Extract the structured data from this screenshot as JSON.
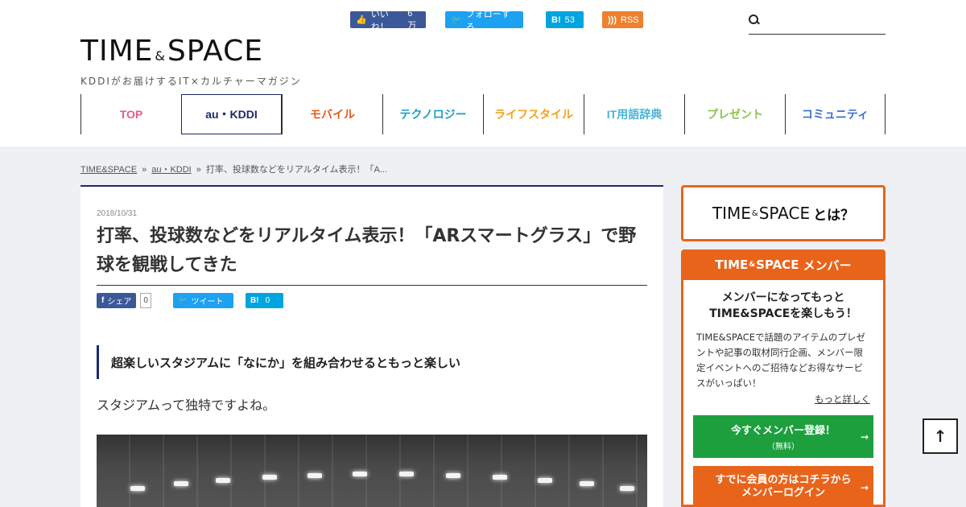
{
  "header": {
    "social": {
      "facebook": {
        "label": "いいね！",
        "count": "6万"
      },
      "twitter": {
        "label": "フォローする"
      },
      "hatena": {
        "icon": "B!",
        "count": "53"
      },
      "rss": {
        "label": "RSS"
      }
    },
    "logo": {
      "word1": "TIME",
      "amp": "&",
      "word2": "SPACE",
      "tagline": "KDDIがお届けするIT×カルチャーマガジン"
    },
    "nav": [
      {
        "label": "TOP",
        "color": "#e95a8a"
      },
      {
        "label": "au・KDDI",
        "color": "#1b2a6b"
      },
      {
        "label": "モバイル",
        "color": "#e85a1c"
      },
      {
        "label": "テクノロジー",
        "color": "#1aa0c8"
      },
      {
        "label": "ライフスタイル",
        "color": "#f3a21a"
      },
      {
        "label": "IT用語辞典",
        "color": "#4ab4d6"
      },
      {
        "label": "プレゼント",
        "color": "#8bc34a"
      },
      {
        "label": "コミュニティ",
        "color": "#3b6fd0"
      }
    ]
  },
  "breadcrumb": {
    "home": "TIME&SPACE",
    "category": "au・KDDI",
    "current": "打率、投球数などをリアルタイム表示！「A..."
  },
  "article": {
    "date": "2018/10/31",
    "title": "打率、投球数などをリアルタイム表示！「ARスマートグラス」で野球を観戦してきた",
    "share": {
      "fb_label": "シェア",
      "fb_count": "0",
      "tw_label": "ツイート",
      "hb_icon": "B!",
      "hb_count": "0"
    },
    "lead": "超楽しいスタジアムに「なにか」を組み合わせるともっと楽しい",
    "paragraph": "スタジアムって独特ですよね。"
  },
  "sidebar": {
    "what": {
      "word1": "TIME",
      "amp": "&",
      "word2": "SPACE",
      "suffix": "とは？"
    },
    "member": {
      "header_word1": "TIME",
      "header_amp": "&",
      "header_word2": "SPACE",
      "header_suffix": " メンバー",
      "catch_line1": "メンバーになってもっと",
      "catch_line2": "TIME&SPACEを楽しもう！",
      "desc": "TIME&SPACEで話題のアイテムのプレゼントや記事の取材同行企画、メンバー限定イベントへのご招待などお得なサービスがいっぱい！",
      "more": "もっと詳しく",
      "register_main": "今すぐメンバー登録！",
      "register_sub": "（無料）",
      "login_line1": "すでに会員の方はコチラから",
      "login_line2": "メンバーログイン"
    }
  },
  "totop": {
    "icon": "arrow-up-icon"
  }
}
